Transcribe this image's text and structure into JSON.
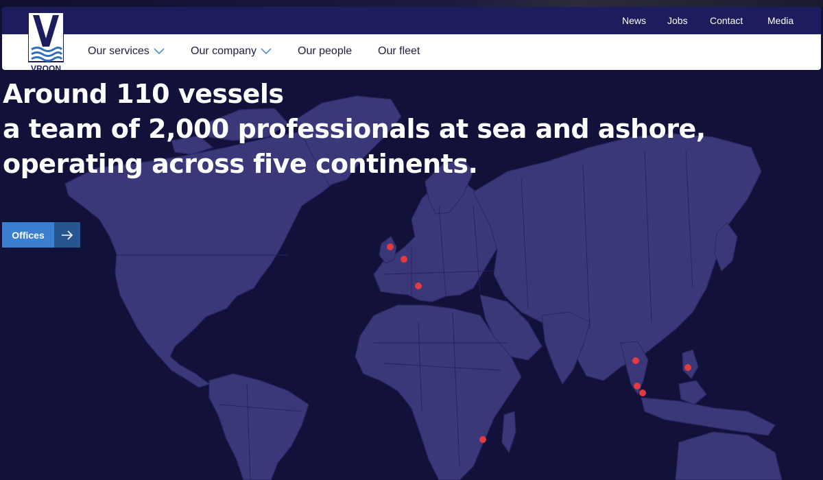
{
  "brand": {
    "name": "VROON"
  },
  "utility_nav": [
    {
      "label": "News"
    },
    {
      "label": "Jobs"
    },
    {
      "label": "Contact"
    },
    {
      "label": "Media"
    }
  ],
  "main_nav": [
    {
      "label": "Our services",
      "has_dropdown": true
    },
    {
      "label": "Our company",
      "has_dropdown": true
    },
    {
      "label": "Our people",
      "has_dropdown": false
    },
    {
      "label": "Our fleet",
      "has_dropdown": false
    }
  ],
  "hero": {
    "line1": "Around 110 vessels",
    "line2": "a team of 2,000 professionals at sea and ashore,",
    "line3": "operating across five continents."
  },
  "offices_button": {
    "label": "Offices",
    "icon": "arrow-right-icon"
  },
  "map": {
    "office_markers": [
      "UK (north)",
      "Netherlands",
      "Italy",
      "Thailand",
      "Philippines",
      "Malaysia",
      "Singapore",
      "Mozambique"
    ]
  },
  "colors": {
    "background": "#12113a",
    "land": "#3a3878",
    "header_bar": "#1d1c5c",
    "accent_blue": "#3a7fd0",
    "marker_red": "#e23a3f"
  }
}
